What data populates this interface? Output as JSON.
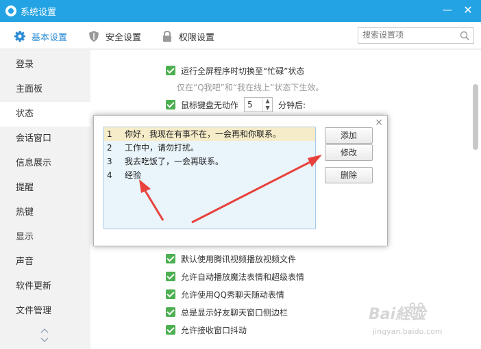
{
  "window": {
    "title": "系统设置",
    "minimize_label": "—",
    "close_label": "✕"
  },
  "tabs": [
    {
      "label": "基本设置",
      "icon": "gear-icon"
    },
    {
      "label": "安全设置",
      "icon": "shield-icon"
    },
    {
      "label": "权限设置",
      "icon": "lock-icon"
    }
  ],
  "search": {
    "placeholder": "搜索设置项",
    "icon": "search-icon"
  },
  "sidebar": {
    "items": [
      {
        "label": "登录"
      },
      {
        "label": "主面板"
      },
      {
        "label": "状态"
      },
      {
        "label": "会话窗口"
      },
      {
        "label": "信息展示"
      },
      {
        "label": "提醒"
      },
      {
        "label": "热键"
      },
      {
        "label": "显示"
      },
      {
        "label": "声音"
      },
      {
        "label": "软件更新"
      },
      {
        "label": "文件管理"
      }
    ],
    "active": "状态"
  },
  "main": {
    "fullscreen_busy": "运行全屏程序时切换至“忙碌”状态",
    "fullscreen_note": "仅在“Q我吧”和“我在线上”状态下生效。",
    "idle_prefix": "鼠标键盘无动作",
    "idle_minutes": "5",
    "idle_suffix": "分钟后:",
    "options": [
      "默认使用腾讯视频播放视频文件",
      "允许自动播放魔法表情和超级表情",
      "允许使用QQ秀聊天随动表情",
      "总是显示好友聊天窗口侧边栏",
      "允许接收窗口抖动"
    ]
  },
  "dialog": {
    "close_label": "×",
    "replies": [
      {
        "num": "1",
        "text": "你好，我现在有事不在，一会再和你联系。"
      },
      {
        "num": "2",
        "text": "工作中，请勿打扰。"
      },
      {
        "num": "3",
        "text": "我去吃饭了，一会再联系。"
      },
      {
        "num": "4",
        "text": "经验"
      }
    ],
    "buttons": {
      "add": "添加",
      "edit": "修改",
      "delete": "删除"
    }
  },
  "watermark": {
    "brand": "Bai経验",
    "url": "jingyan.baidu.com"
  },
  "colors": {
    "titlebar": "#24a3e4",
    "accent": "#2a8ad4",
    "checkbox": "#4caf50",
    "arrow": "#e8413c",
    "selected_row": "#f6ecc9"
  }
}
